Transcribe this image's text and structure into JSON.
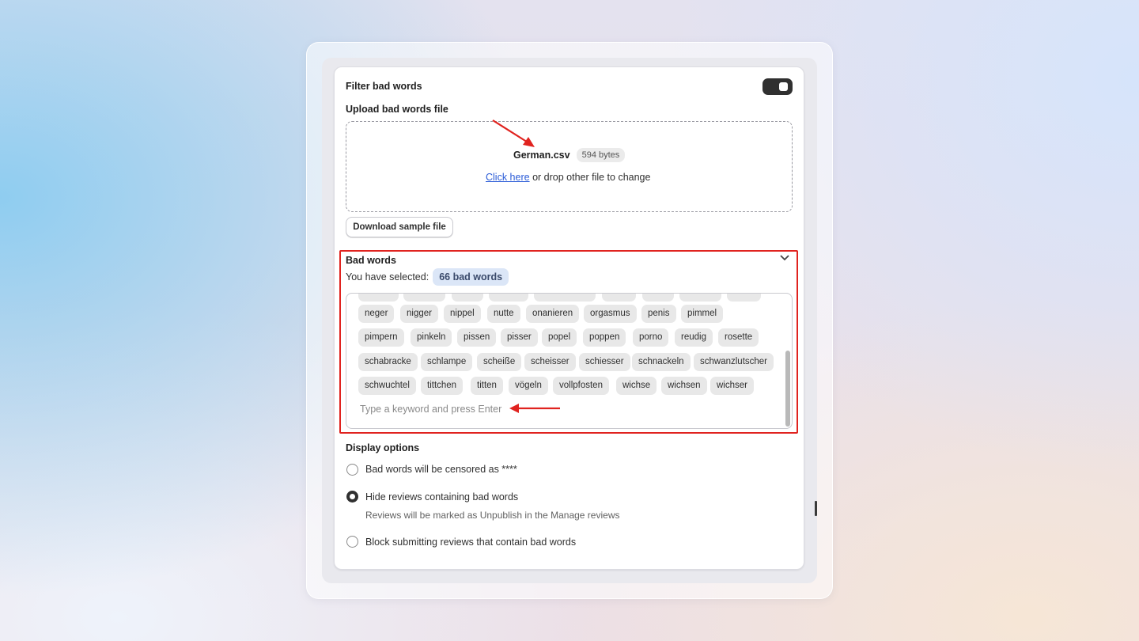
{
  "filter_section": {
    "title": "Filter bad words",
    "toggle_on": true
  },
  "upload": {
    "title": "Upload bad words file",
    "file_name": "German.csv",
    "file_size": "594 bytes",
    "click_here": "Click here",
    "change_text": "or drop other file to change",
    "download_button": "Download sample file"
  },
  "bad_words": {
    "title": "Bad words",
    "selected_label": "You have selected:",
    "selected_count": "66 bad words",
    "tags": [
      "neger",
      "nigger",
      "nippel",
      "nutte",
      "onanieren",
      "orgasmus",
      "penis",
      "pimmel",
      "pimpern",
      "pinkeln",
      "pissen",
      "pisser",
      "popel",
      "poppen",
      "porno",
      "reudig",
      "rosette",
      "schabracke",
      "schlampe",
      "scheiße",
      "scheisser",
      "schiesser",
      "schnackeln",
      "schwanzlutscher",
      "schwuchtel",
      "tittchen",
      "titten",
      "vögeln",
      "vollpfosten",
      "wichse",
      "wichsen",
      "wichser"
    ],
    "input_placeholder": "Type a keyword and press Enter"
  },
  "display_options": {
    "title": "Display options",
    "options": [
      {
        "label": "Bad words will be censored as ****",
        "checked": false
      },
      {
        "label": "Hide reviews containing bad words",
        "sublabel": "Reviews will be marked as Unpublish in the Manage reviews",
        "checked": true
      },
      {
        "label": "Block submitting reviews that contain bad words",
        "checked": false
      }
    ]
  },
  "colors": {
    "highlight": "#e0231f",
    "arrow": "#e0231f",
    "link": "#2a5bd7",
    "count_pill_bg": "#dbe6f7"
  }
}
